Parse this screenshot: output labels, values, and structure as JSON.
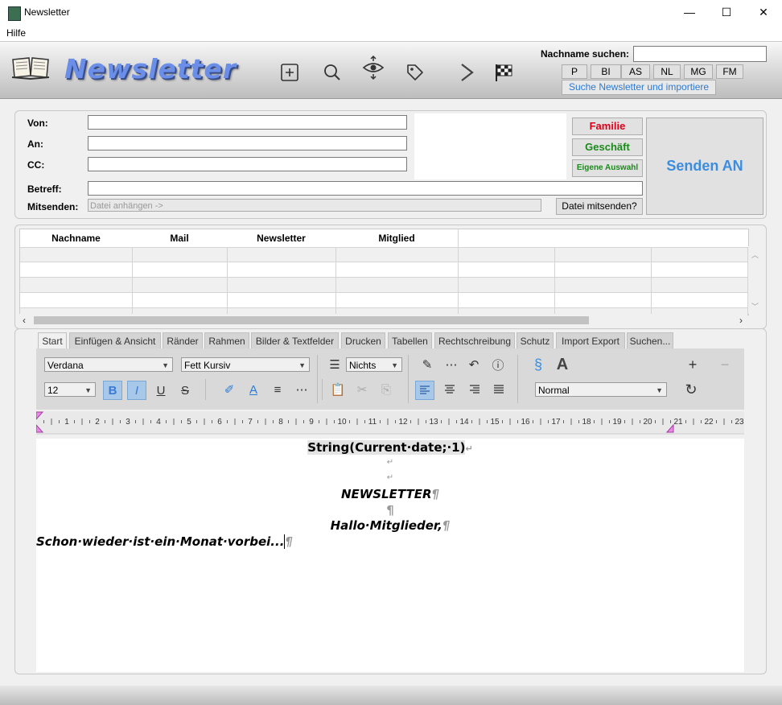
{
  "window": {
    "title": "Newsletter",
    "minimize": "—",
    "maximize": "☐",
    "close": "✕"
  },
  "menu": {
    "help": "Hilfe"
  },
  "header": {
    "logo_text": "Newsletter",
    "search_label": "Nachname suchen:",
    "search_value": "",
    "filters": [
      "P",
      "BI",
      "AS",
      "NL",
      "MG",
      "FM"
    ],
    "import_button": "Suche Newsletter und importiere",
    "icons": [
      "book-icon",
      "add-icon",
      "search-icon",
      "eye-icon",
      "tag-icon",
      "next-icon",
      "checkered-flag-icon"
    ]
  },
  "form": {
    "from_label": "Von:",
    "to_label": "An:",
    "cc_label": "CC:",
    "subject_label": "Betreff:",
    "attach_label": "Mitsenden:",
    "attach_placeholder": "Datei anhängen ->",
    "attach_button": "Datei mitsenden?",
    "family_button": "Familie",
    "business_button": "Geschäft",
    "custom_button": "Eigene Auswahl",
    "send_button": "Senden AN",
    "colors": {
      "family": "#e0001a",
      "business": "#1a8a1a",
      "send": "#3a8de0"
    }
  },
  "table": {
    "columns": [
      "Nachname",
      "Mail",
      "Newsletter",
      "Mitglied",
      "",
      "",
      ""
    ]
  },
  "editor": {
    "tabs": [
      "Start",
      "Einfügen & Ansicht",
      "Ränder",
      "Rahmen",
      "Bilder & Textfelder",
      "Drucken",
      "Tabellen",
      "Rechtschreibung",
      "Schutz",
      "Import Export",
      "Suchen..."
    ],
    "active_tab": "Start",
    "font": "Verdana",
    "font_style": "Fett Kursiv",
    "font_size": "12",
    "list_style": "Nichts",
    "paragraph_style": "Normal",
    "section_symbol": "§",
    "ruler_numbers": [
      "1",
      "2",
      "3",
      "4",
      "5",
      "6",
      "7",
      "8",
      "9",
      "10",
      "11",
      "12",
      "13",
      "14",
      "15",
      "16",
      "17",
      "18",
      "19",
      "20",
      "21",
      "22",
      "23"
    ],
    "doc": {
      "line1": "String(Current·date;·1)",
      "line1_mark": "↵",
      "line2_mark": "↵",
      "line3_mark": "↵",
      "line4": "NEWSLETTER",
      "line4_mark": "¶",
      "line5_mark": "¶",
      "line6": "Hallo·Mitglieder,",
      "line6_mark": "¶",
      "line7": "Schon·wieder·ist·ein·Monat·vorbei...",
      "line7_mark": "¶"
    }
  }
}
